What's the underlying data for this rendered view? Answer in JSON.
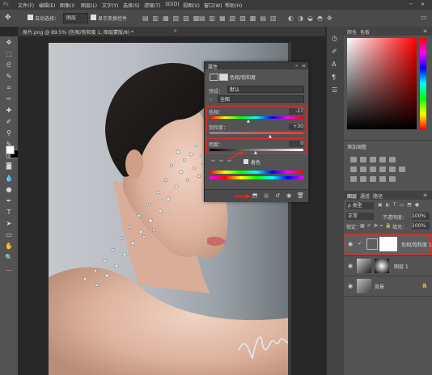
{
  "menu": {
    "items": [
      "文件(F)",
      "编辑(E)",
      "图像(I)",
      "图层(L)",
      "文字(Y)",
      "选择(S)",
      "滤镜(T)",
      "3D(D)",
      "视图(V)",
      "窗口(W)",
      "帮助(H)"
    ]
  },
  "options": {
    "auto_select_label": "自动选择：",
    "auto_select_value": "图层",
    "transform_label": "显示变换控件"
  },
  "document": {
    "tab_title": "原片.png @ 89.5% (色相/饱和度 1, 图层蒙版/8) *"
  },
  "properties": {
    "title": "属性",
    "panel_name": "色相/饱和度",
    "preset_label": "预设：",
    "preset_value": "默认",
    "channel_value": "全图",
    "hue_label": "色相：",
    "hue_value": "-17",
    "saturation_label": "饱和度：",
    "saturation_value": "+30",
    "lightness_label": "明度：",
    "lightness_value": "0",
    "colorize_label": "着色"
  },
  "color_panel": {
    "tabs": [
      "颜色",
      "色板"
    ]
  },
  "adjustments": {
    "title": "添加调整"
  },
  "layers": {
    "tabs": [
      "图层",
      "通道",
      "路径"
    ],
    "kind_label": "ρ 类型",
    "blend_mode": "正常",
    "opacity_label": "不透明度：",
    "opacity_value": "100%",
    "lock_label": "锁定：",
    "fill_label": "填充：",
    "fill_value": "100%",
    "items": [
      {
        "name": "色相/饱和度 1"
      },
      {
        "name": "图层 1"
      },
      {
        "name": "背景"
      }
    ]
  },
  "colors": {
    "highlight_red": "#e62a2a",
    "panel": "#535353"
  }
}
